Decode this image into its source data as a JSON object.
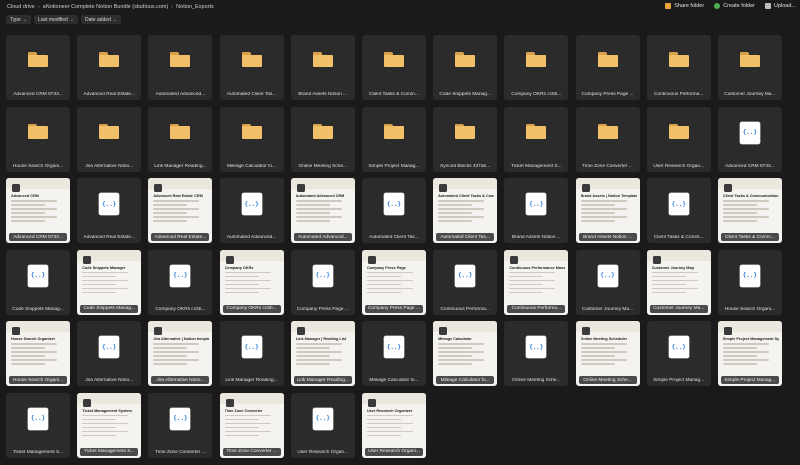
{
  "breadcrumb": [
    "Cloud drive",
    "aNotioneer Complete Notion Bundle (studious.com)",
    "Notion_Exports"
  ],
  "actions": [
    {
      "label": "Share folder",
      "icon": "share-folder-icon",
      "color": "#e8a33b"
    },
    {
      "label": "Create folder",
      "icon": "create-folder-icon",
      "color": "#4caf50"
    },
    {
      "label": "Upload...",
      "icon": "upload-icon",
      "color": "#bdbdbd"
    }
  ],
  "filters": [
    "Type",
    "Last modified",
    "Date added"
  ],
  "tiles": [
    {
      "type": "folder",
      "label": "Advanced CRM 8733..."
    },
    {
      "type": "folder",
      "label": "Advanced Real Estate..."
    },
    {
      "type": "folder",
      "label": "Automated Advanced..."
    },
    {
      "type": "folder",
      "label": "Automated Client Tas..."
    },
    {
      "type": "folder",
      "label": "Brand Assets Notion ..."
    },
    {
      "type": "folder",
      "label": "Client Tasks & Comm..."
    },
    {
      "type": "folder",
      "label": "Code Snippets Manag..."
    },
    {
      "type": "folder",
      "label": "Company OKRs cc5b..."
    },
    {
      "type": "folder",
      "label": "Company Press Page ..."
    },
    {
      "type": "folder",
      "label": "Continuous Performa..."
    },
    {
      "type": "folder",
      "label": "Customer Journey Ma..."
    },
    {
      "type": "folder",
      "label": "House Search Organi..."
    },
    {
      "type": "folder",
      "label": "Jira Alternative Notio..."
    },
    {
      "type": "folder",
      "label": "Link Manager Reading..."
    },
    {
      "type": "folder",
      "label": "Mileage Calculator fo..."
    },
    {
      "type": "folder",
      "label": "Online Meeting Sche..."
    },
    {
      "type": "folder",
      "label": "Simple Project Manag..."
    },
    {
      "type": "folder",
      "label": "Synced Blocks 437de..."
    },
    {
      "type": "folder",
      "label": "Ticket Management S..."
    },
    {
      "type": "folder",
      "label": "Time Zone Converter ..."
    },
    {
      "type": "folder",
      "label": "User Research Organ..."
    },
    {
      "type": "json",
      "label": "Advanced CRM 8733..."
    },
    {
      "type": "doc",
      "label": "Advanced CRM 8733...",
      "title": "Advanced CRM"
    },
    {
      "type": "json",
      "label": "Advanced Real Estate..."
    },
    {
      "type": "doc",
      "label": "Advanced Real Estate...",
      "title": "Advanced Real Estate CRM"
    },
    {
      "type": "json",
      "label": "Automated Advanced..."
    },
    {
      "type": "doc",
      "label": "Automated Advanced...",
      "title": "Automated Advanced CRM"
    },
    {
      "type": "json",
      "label": "Automated Client Tas..."
    },
    {
      "type": "doc",
      "label": "Automated Client Tas...",
      "title": "Automated Client Tasks & Communication Manager"
    },
    {
      "type": "json",
      "label": "Brand Assets Notion ..."
    },
    {
      "type": "doc",
      "label": "Brand Assets Notion ...",
      "title": "Brand Assets | Notion Template"
    },
    {
      "type": "json",
      "label": "Client Tasks & Comm..."
    },
    {
      "type": "doc",
      "label": "Client Tasks & Comm...",
      "title": "Client Tasks & Communication Manager"
    },
    {
      "type": "json",
      "label": "Code Snippets Manag..."
    },
    {
      "type": "doc",
      "label": "Code Snippets Manag...",
      "title": "Code Snippets Manager"
    },
    {
      "type": "json",
      "label": "Company OKRs cc5b..."
    },
    {
      "type": "doc",
      "label": "Company OKRs cc5b...",
      "title": "Company OKRs"
    },
    {
      "type": "json",
      "label": "Company Press Page ..."
    },
    {
      "type": "doc",
      "label": "Company Press Page ...",
      "title": "Company Press Page"
    },
    {
      "type": "json",
      "label": "Continuous Performa..."
    },
    {
      "type": "doc",
      "label": "Continuous Performa...",
      "title": "Continuous Performance Management System"
    },
    {
      "type": "json",
      "label": "Customer Journey Ma..."
    },
    {
      "type": "doc",
      "label": "Customer Journey Ma...",
      "title": "Customer Journey Map"
    },
    {
      "type": "json",
      "label": "House Search Organi..."
    },
    {
      "type": "doc",
      "label": "House Search Organi...",
      "title": "House Search Organizer"
    },
    {
      "type": "json",
      "label": "Jira Alternative Notio..."
    },
    {
      "type": "doc",
      "label": "Jira Alternative Notio...",
      "title": "Jira Alternative | Notion template"
    },
    {
      "type": "json",
      "label": "Link Manager Reading..."
    },
    {
      "type": "doc",
      "label": "Link Manager Reading...",
      "title": "Link Manager | Reading List"
    },
    {
      "type": "json",
      "label": "Mileage Calculator fo..."
    },
    {
      "type": "doc",
      "label": "Mileage Calculator fo...",
      "title": "Mileage Calculator"
    },
    {
      "type": "json",
      "label": "Online Meeting Sche..."
    },
    {
      "type": "doc",
      "label": "Online Meeting Sche...",
      "title": "Online Meeting Scheduler"
    },
    {
      "type": "json",
      "label": "Simple Project Manag..."
    },
    {
      "type": "doc",
      "label": "Simple Project Manag...",
      "title": "Simple Project Management System"
    },
    {
      "type": "json",
      "label": "Ticket Management S..."
    },
    {
      "type": "doc",
      "label": "Ticket Management S...",
      "title": "Ticket Management System"
    },
    {
      "type": "json",
      "label": "Time Zone Converter ..."
    },
    {
      "type": "doc",
      "label": "Time Zone Converter ...",
      "title": "Time Zone Converter"
    },
    {
      "type": "json",
      "label": "User Research Organ..."
    },
    {
      "type": "doc",
      "label": "User Research Organi...",
      "title": "User Research Organizer"
    }
  ]
}
